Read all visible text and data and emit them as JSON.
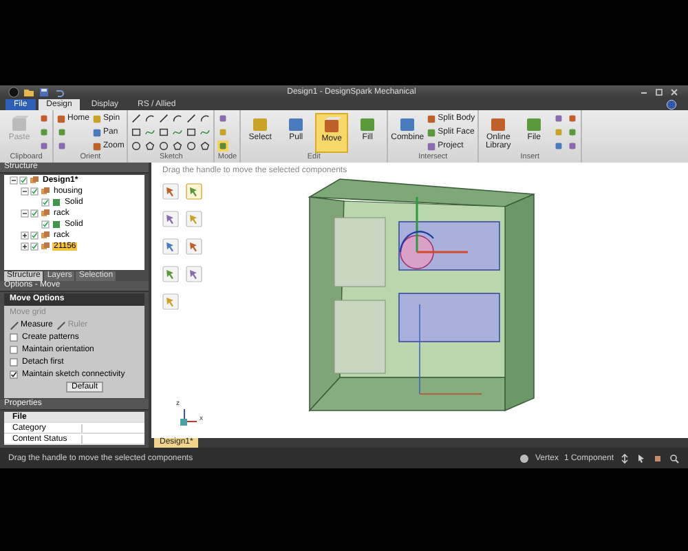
{
  "window": {
    "title": "Design1 - DesignSpark Mechanical"
  },
  "menu_tabs": [
    {
      "label": "File",
      "kind": "file",
      "selected": false
    },
    {
      "label": "Design",
      "kind": "tab",
      "selected": true
    },
    {
      "label": "Display",
      "kind": "tab",
      "selected": false
    },
    {
      "label": "RS / Allied",
      "kind": "tab",
      "selected": false
    }
  ],
  "ribbon": [
    {
      "name": "Clipboard",
      "buttons": [
        {
          "kind": "large",
          "label": "Paste",
          "disabled": true
        },
        {
          "kind": "icon"
        },
        {
          "kind": "icon"
        },
        {
          "kind": "icon"
        }
      ]
    },
    {
      "name": "Orient",
      "buttons": [
        {
          "kind": "small",
          "label": "Home"
        },
        {
          "kind": "icon"
        },
        {
          "kind": "icon"
        },
        {
          "kind": "small",
          "label": "Spin"
        },
        {
          "kind": "small",
          "label": "Pan"
        },
        {
          "kind": "small",
          "label": "Zoom"
        }
      ]
    },
    {
      "name": "Sketch",
      "buttons": [
        {
          "kind": "icon"
        },
        {
          "kind": "icon"
        },
        {
          "kind": "icon"
        },
        {
          "kind": "icon"
        },
        {
          "kind": "icon"
        },
        {
          "kind": "icon"
        },
        {
          "kind": "icon"
        },
        {
          "kind": "icon"
        },
        {
          "kind": "icon"
        },
        {
          "kind": "icon"
        },
        {
          "kind": "icon"
        },
        {
          "kind": "icon"
        },
        {
          "kind": "icon"
        },
        {
          "kind": "icon"
        },
        {
          "kind": "icon"
        },
        {
          "kind": "icon"
        },
        {
          "kind": "icon"
        },
        {
          "kind": "icon"
        }
      ]
    },
    {
      "name": "Mode",
      "buttons": [
        {
          "kind": "icon",
          "selected": false
        },
        {
          "kind": "icon",
          "selected": false
        },
        {
          "kind": "icon",
          "selected": true
        }
      ]
    },
    {
      "name": "Edit",
      "buttons": [
        {
          "kind": "large",
          "label": "Select",
          "selected": false
        },
        {
          "kind": "large",
          "label": "Pull",
          "selected": false
        },
        {
          "kind": "large",
          "label": "Move",
          "selected": true
        },
        {
          "kind": "large",
          "label": "Fill",
          "selected": false
        }
      ]
    },
    {
      "name": "Intersect",
      "buttons": [
        {
          "kind": "large",
          "label": "Combine"
        },
        {
          "kind": "small",
          "label": "Split Body"
        },
        {
          "kind": "small",
          "label": "Split Face"
        },
        {
          "kind": "small",
          "label": "Project"
        }
      ]
    },
    {
      "name": "Insert",
      "buttons": [
        {
          "kind": "large",
          "label": "Online Library"
        },
        {
          "kind": "large",
          "label": "File"
        },
        {
          "kind": "icon"
        },
        {
          "kind": "icon"
        },
        {
          "kind": "icon"
        },
        {
          "kind": "icon"
        },
        {
          "kind": "icon"
        },
        {
          "kind": "icon"
        }
      ]
    }
  ],
  "structure": {
    "title": "Structure",
    "tree": [
      {
        "label": "Design1*",
        "checked": true,
        "expanded": true,
        "selected": false,
        "children": [
          {
            "label": "housing",
            "checked": true,
            "expanded": true,
            "selected": false,
            "children": [
              {
                "label": "Solid",
                "checked": true,
                "selected": false
              }
            ]
          },
          {
            "label": "rack",
            "checked": true,
            "expanded": true,
            "selected": false,
            "children": [
              {
                "label": "Solid",
                "checked": true,
                "selected": false
              }
            ]
          },
          {
            "label": "rack",
            "checked": true,
            "expanded": false,
            "selected": false
          },
          {
            "label": "21156",
            "checked": true,
            "expanded": false,
            "selected": true
          }
        ]
      }
    ],
    "tabs": [
      {
        "label": "Structure",
        "selected": true
      },
      {
        "label": "Layers",
        "selected": false
      },
      {
        "label": "Selection",
        "selected": false
      }
    ]
  },
  "options": {
    "title": "Options - Move",
    "section": "Move Options",
    "rows": [
      {
        "kind": "button",
        "label": "Move grid",
        "disabled": true
      },
      {
        "kind": "tools",
        "items": [
          {
            "label": "Measure",
            "disabled": false
          },
          {
            "label": "Ruler",
            "disabled": true
          }
        ]
      },
      {
        "kind": "check",
        "label": "Create patterns",
        "checked": false
      },
      {
        "kind": "check",
        "label": "Maintain orientation",
        "checked": false
      },
      {
        "kind": "check",
        "label": "Detach first",
        "checked": false
      },
      {
        "kind": "check",
        "label": "Maintain sketch connectivity",
        "checked": true
      },
      {
        "kind": "dropdown",
        "value": "Default"
      }
    ]
  },
  "properties": {
    "title": "Properties",
    "rows": [
      {
        "kind": "group",
        "label": "File"
      },
      {
        "kind": "field",
        "label": "Category"
      },
      {
        "kind": "field",
        "label": "Content Status"
      }
    ]
  },
  "viewport": {
    "hint": "Drag the handle to move the selected components",
    "palette": [
      {
        "selected": false
      },
      {
        "selected": true
      },
      {
        "selected": false
      },
      {
        "selected": false
      },
      {
        "selected": false
      },
      {
        "selected": false
      },
      {
        "selected": false
      },
      {
        "selected": false
      },
      {
        "selected": false
      }
    ],
    "axis_z": "z",
    "axis_x": "x",
    "doc_tab": "Design1*"
  },
  "status_bar": {
    "message": "Drag the handle to move the selected components",
    "filter": "Vertex",
    "selection": "1 Component"
  }
}
